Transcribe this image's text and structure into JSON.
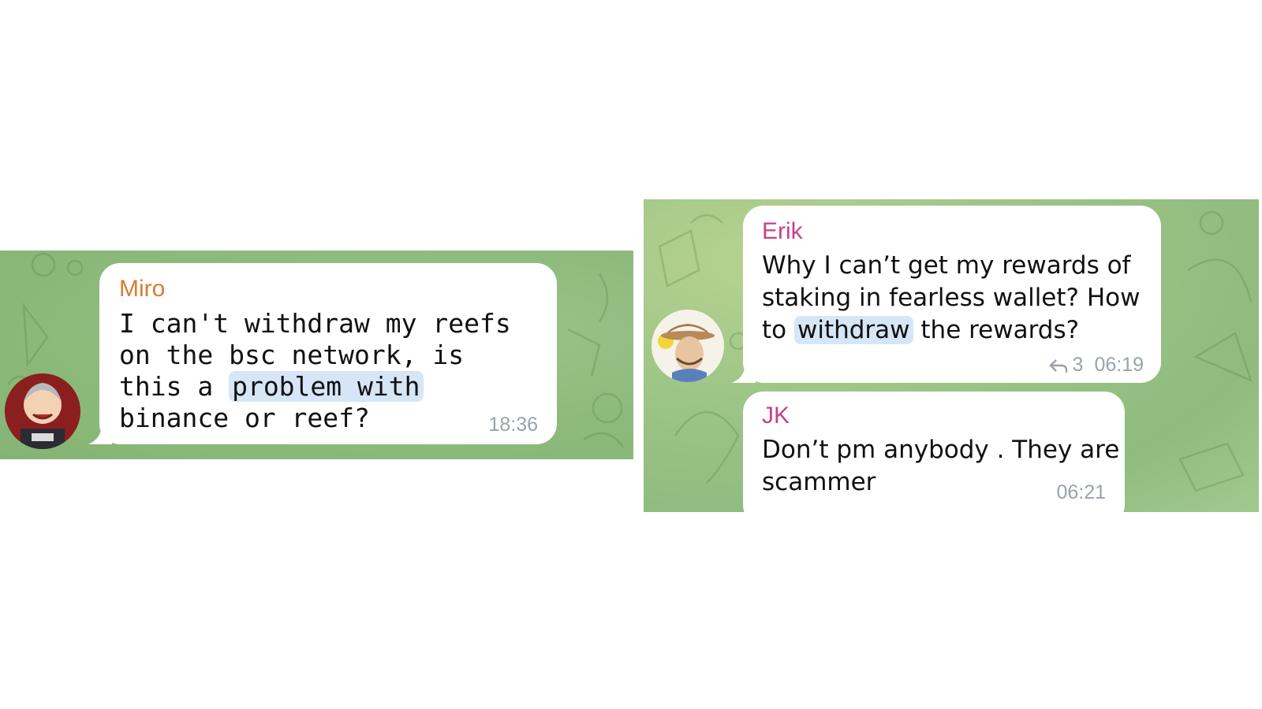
{
  "left_chat": {
    "sender": "Miro",
    "sender_color": "#d57f2e",
    "lines": [
      "I can't withdraw my reefs",
      "on the bsc network, is"
    ],
    "line3_pre": "this a ",
    "line3_highlight": "problem with",
    "line4": "binance or reef?",
    "time": "18:36",
    "avatar_icon": "anime-character-avatar"
  },
  "right_chat": {
    "msg1": {
      "sender": "Erik",
      "sender_color": "#c6418a",
      "line1": "Why I can’t get my rewards of",
      "line2": "staking in fearless wallet? How",
      "line3_pre": "to ",
      "line3_highlight": "withdraw",
      "line3_post": " the rewards?",
      "reply_count": "3",
      "time": "06:19",
      "avatar_icon": "cowboy-portrait-avatar"
    },
    "msg2": {
      "sender": "JK",
      "sender_color": "#c6418a",
      "line1": "Don’t pm anybody . They are",
      "line2": "scammer",
      "time": "06:21"
    }
  },
  "colors": {
    "chat_background": "#8fbc7e",
    "highlight": "#d6e6f6",
    "bubble": "#ffffff",
    "timestamp": "#9aa3a9"
  }
}
